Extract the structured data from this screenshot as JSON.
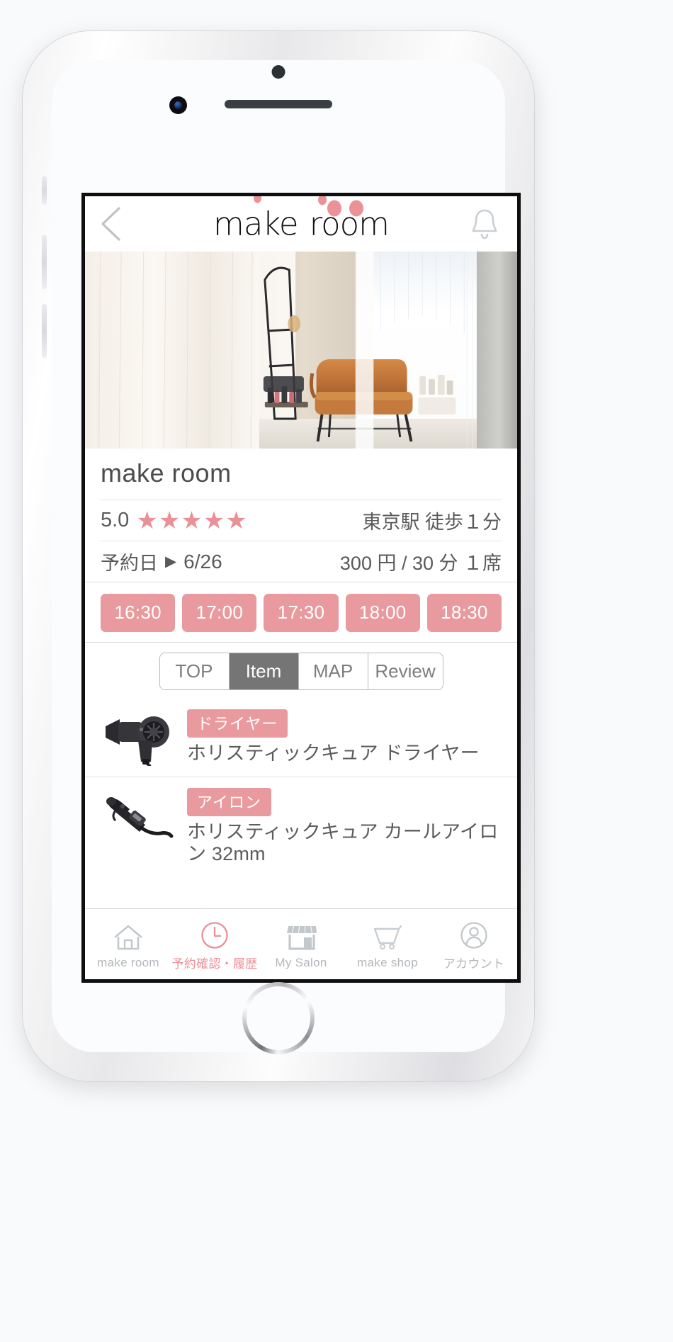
{
  "device": {
    "sensor": "proximity-sensor",
    "camera": "front-camera",
    "speaker": "earpiece-speaker",
    "home_button": "home-button"
  },
  "header": {
    "back_icon": "chevron-left-icon",
    "bell_icon": "bell-icon",
    "logo_part1": "make",
    "logo_part2": "room"
  },
  "salon": {
    "photo_alt": "salon-interior-photo",
    "name": "make room",
    "rating_score": "5.0",
    "stars": [
      "★",
      "★",
      "★",
      "★",
      "★"
    ],
    "star_count": 5,
    "access": "東京駅 徒歩１分",
    "booking_date_label": "予約日",
    "booking_date_arrow": "▶",
    "booking_date_value": "6/26",
    "price": "300 円 / 30 分 １席"
  },
  "time_slots": [
    "16:30",
    "17:00",
    "17:30",
    "18:00",
    "18:30"
  ],
  "tabs": [
    {
      "label": "TOP",
      "active": false
    },
    {
      "label": "Item",
      "active": true
    },
    {
      "label": "MAP",
      "active": false
    },
    {
      "label": "Review",
      "active": false
    }
  ],
  "products": [
    {
      "icon": "hair-dryer-icon",
      "badge": "ドライヤー",
      "name": "ホリスティックキュア ドライヤー"
    },
    {
      "icon": "curling-iron-icon",
      "badge": "アイロン",
      "name": "ホリスティックキュア カールアイロン 32mm"
    }
  ],
  "bottom_nav": [
    {
      "label": "make room",
      "icon": "home-icon",
      "active": false
    },
    {
      "label": "予約確認・履歴",
      "icon": "clock-icon",
      "active": true
    },
    {
      "label": "My Salon",
      "icon": "storefront-icon",
      "active": false
    },
    {
      "label": "make shop",
      "icon": "cart-icon",
      "active": false
    },
    {
      "label": "アカウント",
      "icon": "account-icon",
      "active": false
    }
  ],
  "colors": {
    "accent_pink": "#e99a9e",
    "accent_pink_text": "#ea9097",
    "tab_active_bg": "#757575",
    "text_gray": "#5a5a5a",
    "nav_inactive": "#b4b8bc"
  }
}
